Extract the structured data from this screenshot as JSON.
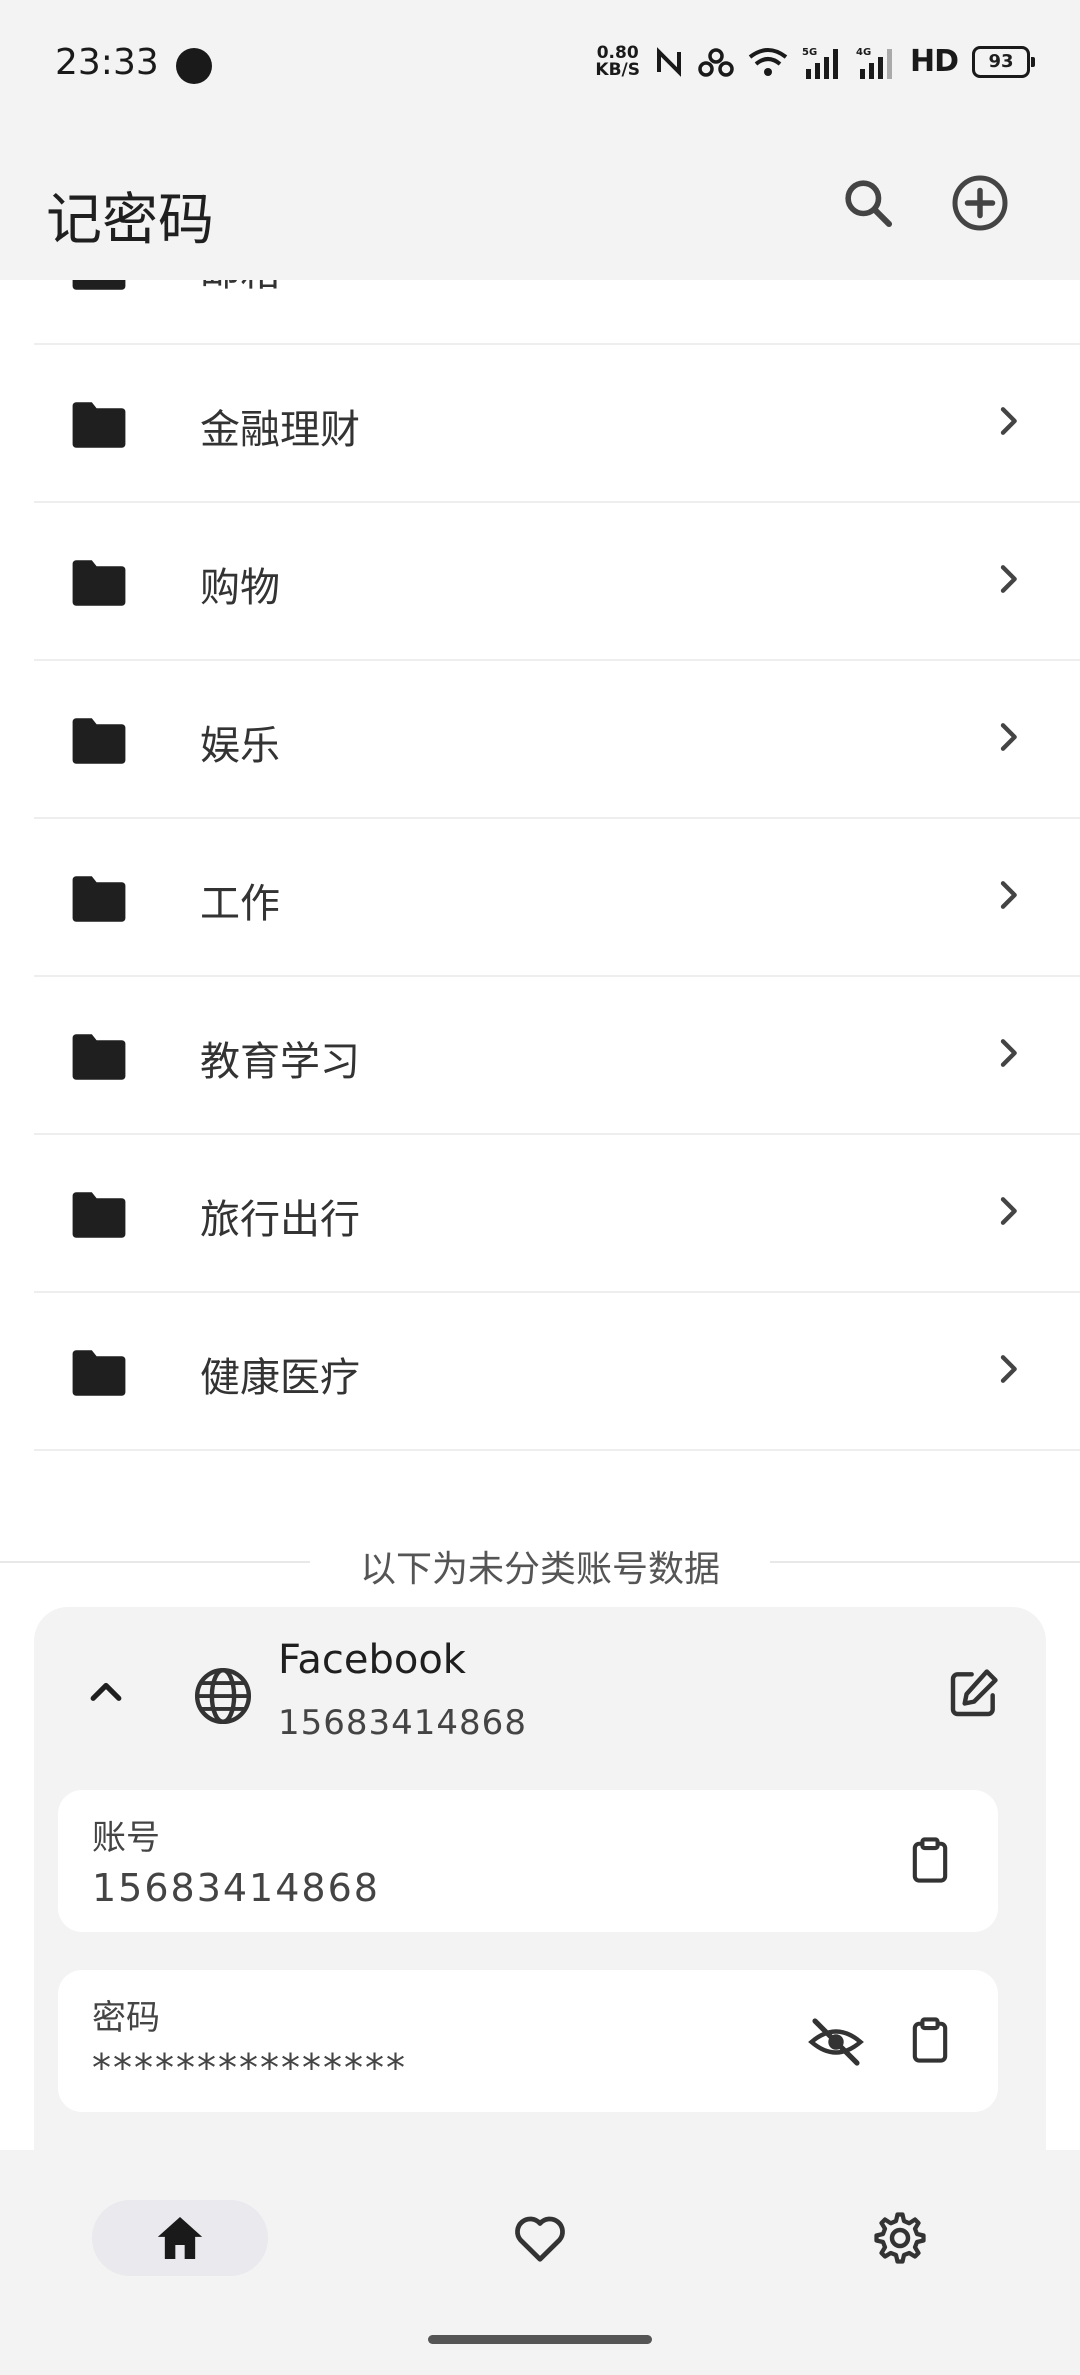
{
  "status_bar": {
    "time": "23:33",
    "net_speed_value": "0.80",
    "net_speed_unit": "KB/S",
    "signal_1_label": "5G",
    "signal_2_label": "4G",
    "hd_label": "HD",
    "battery": "93"
  },
  "app_bar": {
    "title": "记密码",
    "icons": [
      "search-icon",
      "add-circle-icon"
    ]
  },
  "folders": [
    {
      "label": "邮箱"
    },
    {
      "label": "金融理财"
    },
    {
      "label": "购物"
    },
    {
      "label": "娱乐"
    },
    {
      "label": "工作"
    },
    {
      "label": "教育学习"
    },
    {
      "label": "旅行出行"
    },
    {
      "label": "健康医疗"
    }
  ],
  "uncategorized_header": "以下为未分类账号数据",
  "entry": {
    "title": "Facebook",
    "subtitle": "15683414868",
    "account_label": "账号",
    "account_value": "15683414868",
    "password_label": "密码",
    "password_value": "***************"
  },
  "bottom_nav": {
    "items": [
      "home-icon",
      "heart-icon",
      "settings-icon"
    ],
    "active": "home-icon"
  },
  "colors": {
    "background": "#f3f3f3",
    "surface": "#ffffff",
    "icon": "#1f1f1f",
    "nav_active_pill": "#e9e9ee"
  }
}
